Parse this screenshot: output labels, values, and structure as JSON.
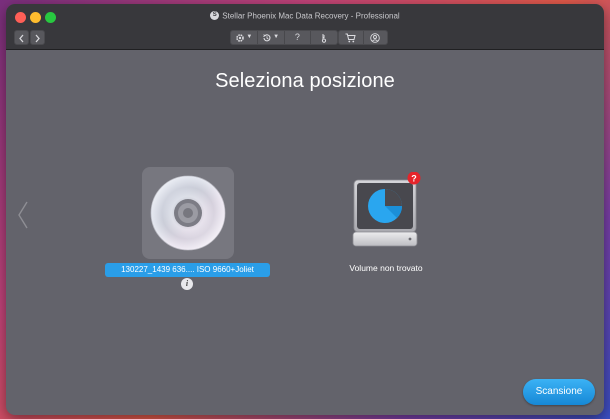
{
  "window": {
    "title": "Stellar Phoenix Mac Data Recovery - Professional"
  },
  "toolbar": {
    "back_icon": "chevron-left-icon",
    "forward_icon": "chevron-right-icon",
    "buttons": [
      {
        "name": "settings",
        "icon": "gear-icon",
        "has_menu": true
      },
      {
        "name": "history",
        "icon": "history-icon",
        "has_menu": true
      },
      {
        "name": "help",
        "icon": "help-icon",
        "label": "?"
      },
      {
        "name": "activation",
        "icon": "key-icon"
      },
      {
        "name": "cart",
        "icon": "cart-icon"
      },
      {
        "name": "account",
        "icon": "user-icon"
      }
    ]
  },
  "main": {
    "heading": "Seleziona posizione",
    "volumes": [
      {
        "icon": "cd-icon",
        "label": "130227_1439 636.... ISO 9660+Joliet",
        "selected": true,
        "info_label": "i"
      },
      {
        "icon": "hard-drive-icon",
        "label": "Volume non trovato",
        "badge": "?",
        "selected": false
      }
    ],
    "scan_button": "Scansione"
  },
  "colors": {
    "accent": "#2a9ee8",
    "window_bg": "#63636b",
    "titlebar_bg": "#38383c",
    "badge_red": "#e5242a"
  }
}
